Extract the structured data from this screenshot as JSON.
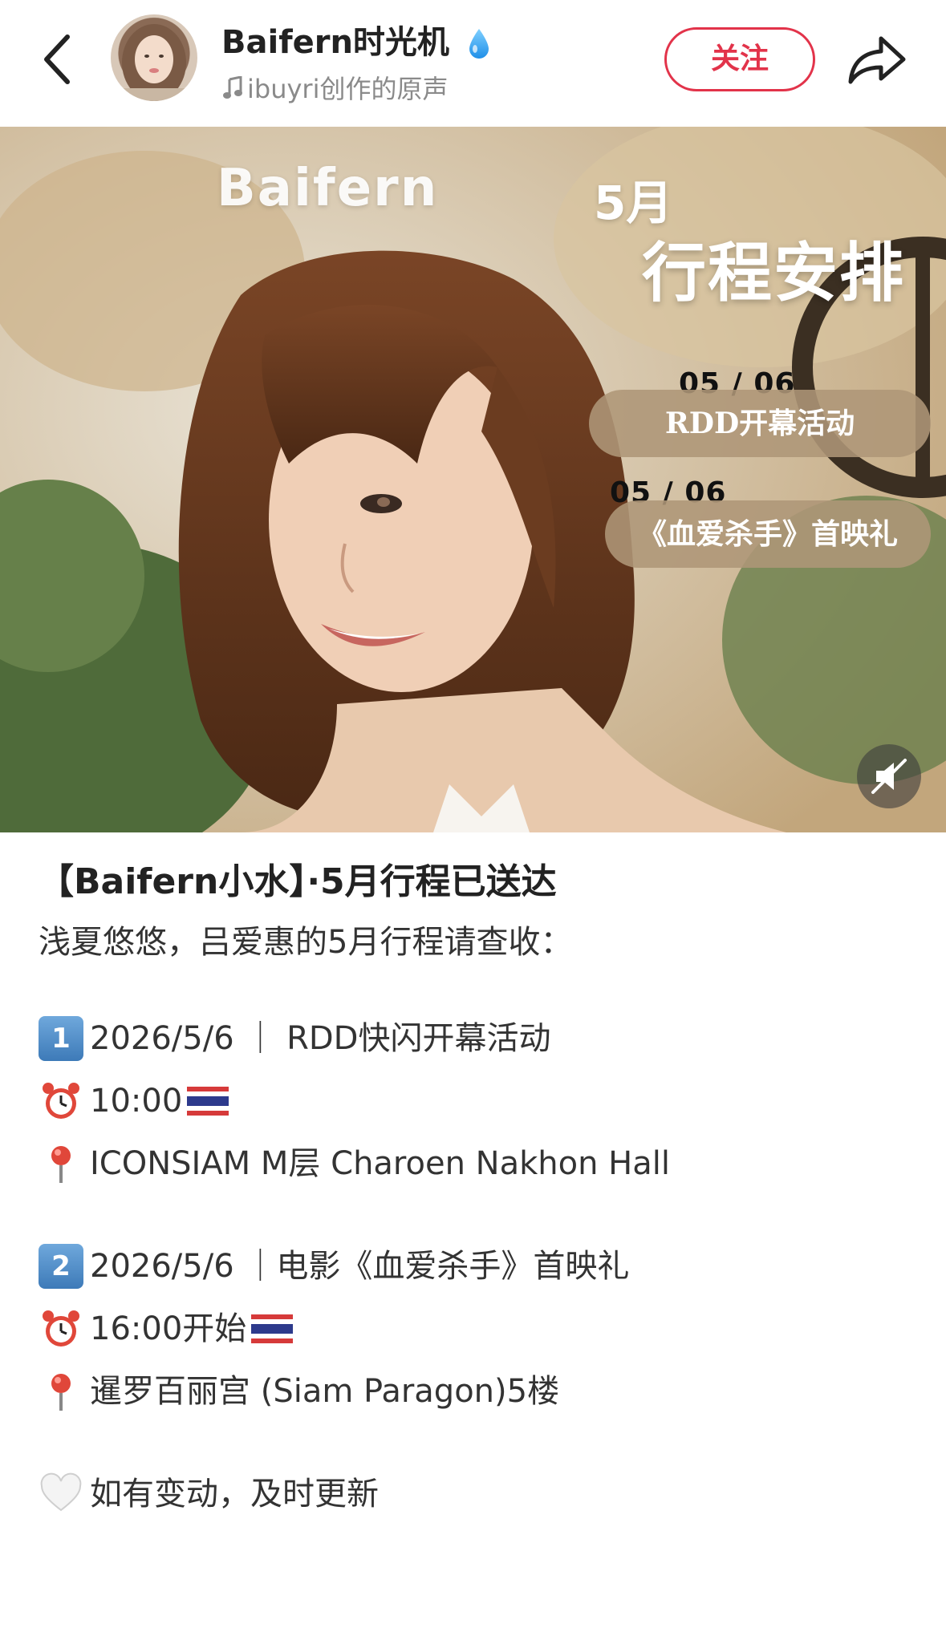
{
  "header": {
    "author_name": "Baifern时光机",
    "music": "ibuyri创作的原声",
    "follow_label": "关注",
    "accent_color": "#e2334a"
  },
  "cover": {
    "brand": "Baifern",
    "month": "5月",
    "title": "行程安排",
    "events": [
      {
        "date": "05 / 06",
        "label": "RDD开幕活动"
      },
      {
        "date": "05 / 06",
        "label": "《血爱杀手》首映礼"
      }
    ]
  },
  "post": {
    "title": "【Baifern小水】·5月行程已送达",
    "intro": "浅夏悠悠，吕爱惠的5月行程请查收：",
    "items": [
      {
        "number": "1",
        "line": "2026/5/6 ｜ RDD快闪开幕活动",
        "time": "10:00",
        "place": "ICONSIAM M层 Charoen Nakhon Hall"
      },
      {
        "number": "2",
        "line": "2026/5/6 ｜电影《血爱杀手》首映礼",
        "time": "16:00开始",
        "place": "暹罗百丽宫 (Siam Paragon)5楼"
      }
    ],
    "closing": "如有变动，及时更新"
  },
  "icons": [
    "back-icon",
    "verified-droplet-icon",
    "music-note-icon",
    "share-icon",
    "mute-icon",
    "keycap-icon",
    "alarm-clock-icon",
    "thailand-flag-icon",
    "pin-icon",
    "white-heart-icon"
  ]
}
